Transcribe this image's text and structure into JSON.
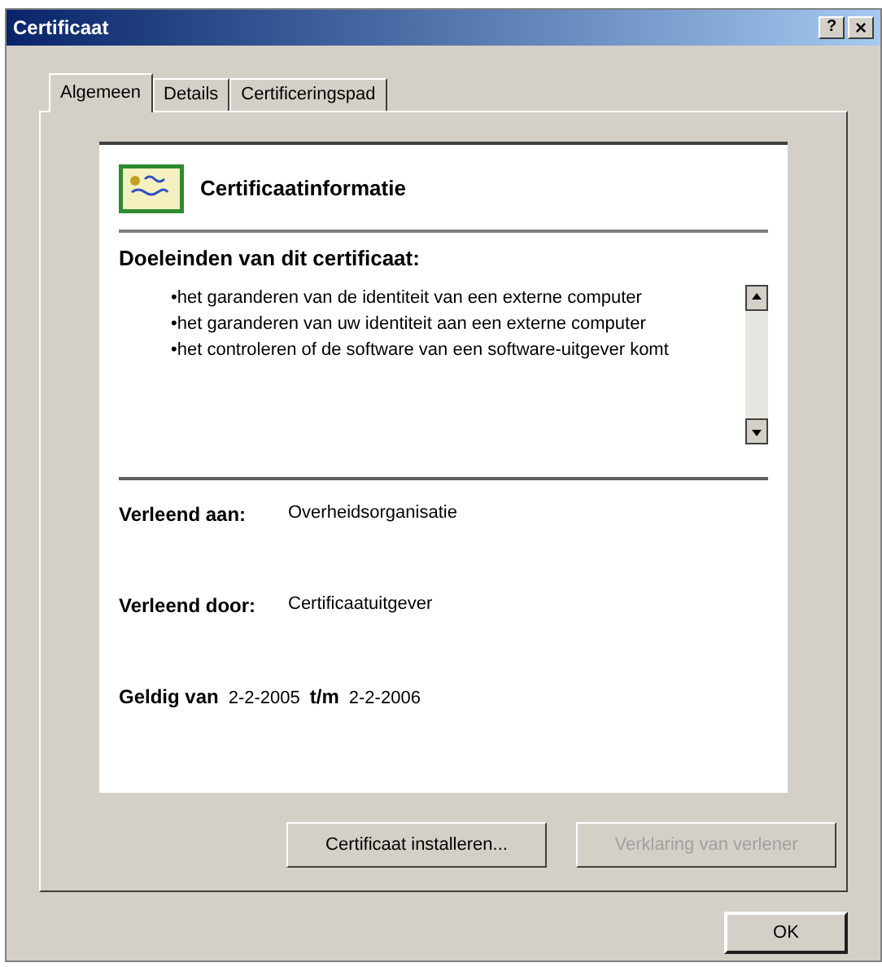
{
  "window": {
    "title": "Certificaat",
    "help_button": "?",
    "close_button": "×"
  },
  "tabs": [
    {
      "label": "Algemeen",
      "selected": true
    },
    {
      "label": "Details",
      "selected": false
    },
    {
      "label": "Certificeringspad",
      "selected": false
    }
  ],
  "info": {
    "heading": "Certificaatinformatie",
    "purposes_title": "Doeleinden van dit certificaat:",
    "purposes": [
      "•het garanderen van de identiteit van een externe computer",
      "•het garanderen van uw identiteit aan een externe computer",
      "•het controleren of de software van een software-uitgever komt"
    ],
    "issued_to_label": "Verleend aan:",
    "issued_to": "Overheidsorganisatie",
    "issued_by_label": "Verleend door:",
    "issued_by": "Certificaatuitgever",
    "valid_label": "Geldig van",
    "valid_from": "2-2-2005",
    "valid_to_label": "t/m",
    "valid_to": "2-2-2006"
  },
  "buttons": [
    {
      "label": "Certificaat installeren...",
      "disabled": false
    },
    {
      "label": "Verklaring van verlener",
      "disabled": true
    }
  ],
  "ok_button": "OK"
}
